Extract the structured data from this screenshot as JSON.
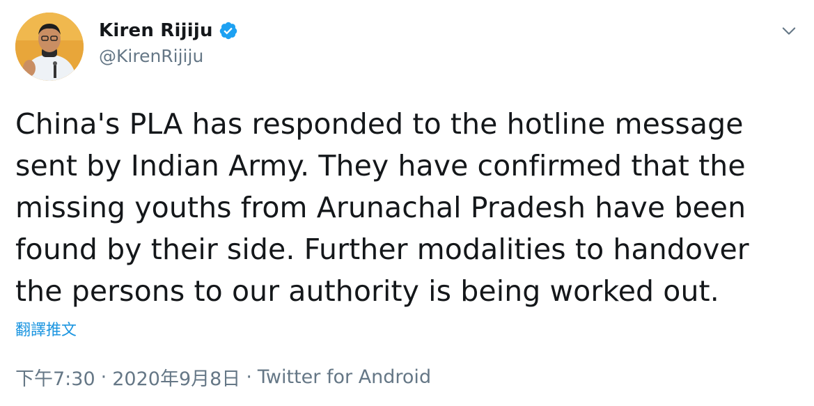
{
  "tweet": {
    "author": {
      "display_name": "Kiren Rijiju",
      "handle": "@KirenRijiju",
      "verified": true,
      "avatar_icon": "profile-photo"
    },
    "menu_icon": "chevron-down-icon",
    "text_lines": [
      "China's PLA has responded to the hotline message",
      "sent by Indian Army. They have confirmed that the",
      "missing youths from Arunachal Pradesh have been",
      "found by their side. Further modalities to handover",
      "the persons to our authority is being worked out."
    ],
    "translate_label": "翻譯推文",
    "time": "下午7:30",
    "date": "2020年9月8日",
    "separator": "·",
    "source": "Twitter for Android"
  },
  "colors": {
    "text": "#14171a",
    "muted": "#657786",
    "link": "#1b95e0",
    "verified": "#1da1f2"
  }
}
